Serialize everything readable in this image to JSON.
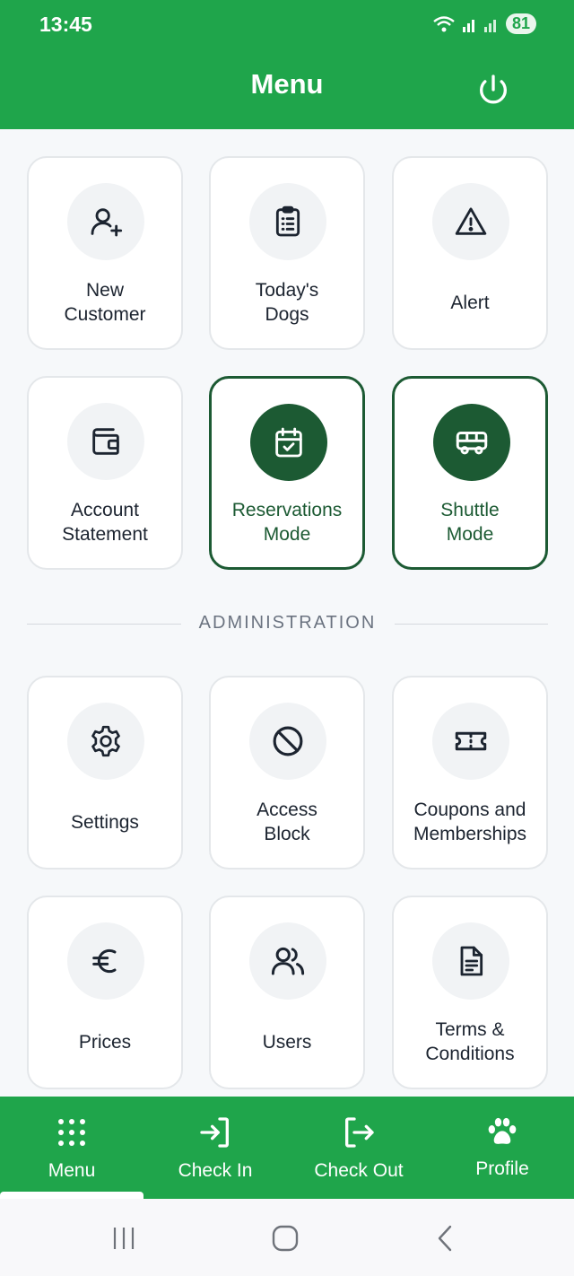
{
  "status_bar": {
    "time": "13:45",
    "battery": "81"
  },
  "header": {
    "title": "Menu"
  },
  "main_tiles": [
    {
      "label_lines": [
        "New",
        "Customer"
      ],
      "icon": "user-plus-icon"
    },
    {
      "label_lines": [
        "Today's",
        "Dogs"
      ],
      "icon": "clipboard-list-icon"
    },
    {
      "label_lines": [
        "Alert"
      ],
      "icon": "alert-triangle-icon"
    },
    {
      "label_lines": [
        "Account",
        "Statement"
      ],
      "icon": "wallet-icon"
    },
    {
      "label_lines": [
        "Reservations",
        "Mode"
      ],
      "icon": "calendar-check-icon",
      "active": true
    },
    {
      "label_lines": [
        "Shuttle",
        "Mode"
      ],
      "icon": "bus-icon",
      "active": true
    }
  ],
  "administration": {
    "title": "ADMINISTRATION",
    "tiles": [
      {
        "label_lines": [
          "Settings"
        ],
        "icon": "gear-icon"
      },
      {
        "label_lines": [
          "Access",
          "Block"
        ],
        "icon": "ban-icon"
      },
      {
        "label_lines": [
          "Coupons and",
          "Memberships"
        ],
        "icon": "ticket-icon"
      },
      {
        "label_lines": [
          "Prices"
        ],
        "icon": "euro-icon"
      },
      {
        "label_lines": [
          "Users"
        ],
        "icon": "users-icon"
      },
      {
        "label_lines": [
          "Terms &",
          "Conditions"
        ],
        "icon": "document-icon"
      }
    ]
  },
  "bottom_nav": [
    {
      "label": "Menu",
      "icon": "grid-dots-icon",
      "active": true
    },
    {
      "label": "Check In",
      "icon": "login-arrow-icon"
    },
    {
      "label": "Check Out",
      "icon": "logout-arrow-icon"
    },
    {
      "label": "Profile",
      "icon": "paw-icon"
    }
  ],
  "colors": {
    "brand_green": "#1fa54b",
    "active_dark_green": "#1c5a33",
    "icon_circle_bg": "#f1f3f5",
    "text_dark": "#1c2430",
    "section_gray": "#6b7380"
  }
}
